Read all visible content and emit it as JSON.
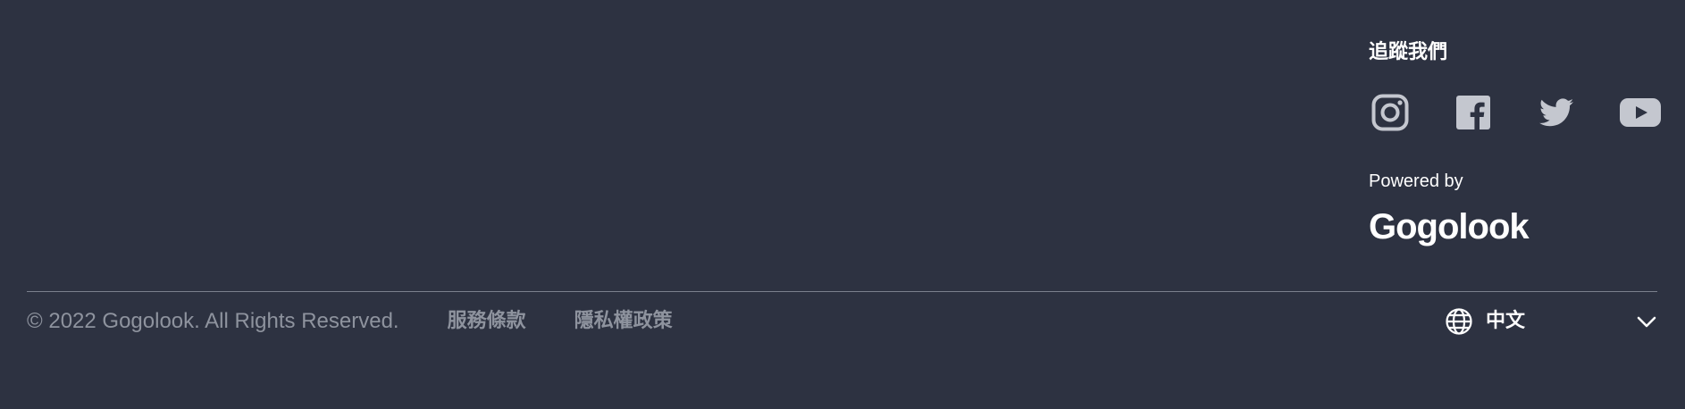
{
  "follow": {
    "title": "追蹤我們",
    "socials": [
      {
        "icon": "instagram-icon"
      },
      {
        "icon": "facebook-icon"
      },
      {
        "icon": "twitter-icon"
      },
      {
        "icon": "youtube-icon"
      }
    ]
  },
  "powered": {
    "label": "Powered by",
    "brand": "Gogolook"
  },
  "bottom": {
    "copyright": "© 2022 Gogolook. All Rights Reserved.",
    "links": [
      {
        "label": "服務條款"
      },
      {
        "label": "隱私權政策"
      }
    ]
  },
  "language": {
    "selected": "中文",
    "icon": "globe-icon",
    "chevron": "chevron-down-icon"
  },
  "colors": {
    "background": "#2d3241",
    "icon": "#c4c7cf",
    "muted_text": "#8e939e",
    "divider": "#7b808d"
  }
}
